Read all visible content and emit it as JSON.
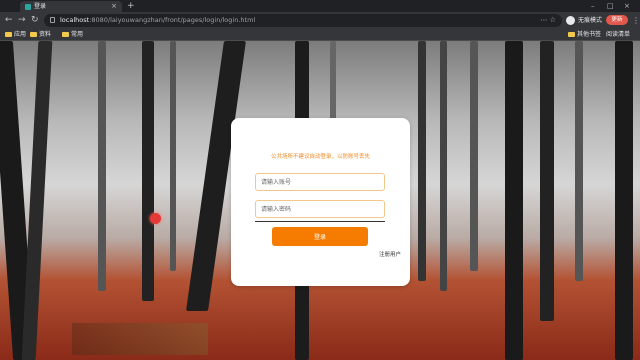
{
  "browser": {
    "tab_title": "登录",
    "tab_close": "×",
    "new_tab": "+",
    "window_controls": [
      "–",
      "□",
      "×"
    ],
    "nav": {
      "back": "←",
      "forward": "→",
      "reload": "↻"
    },
    "url_host": "localhost",
    "url_path": ":8080/laiyouwangzhan/front/pages/login/login.html",
    "omnibox_icons": "⋯ ☆",
    "profile_label": "无痕模式",
    "update_label": "更新",
    "menu": "⋮",
    "bookmarks": {
      "apps": "应用",
      "resources": "资料",
      "common": "常用",
      "other_bookmarks": "其他书签",
      "reading_list": "阅读清单"
    }
  },
  "login": {
    "notice": "公共场所不建议自动登录，以防账号丢失",
    "account_placeholder": "请输入账号",
    "password_placeholder": "请输入密码",
    "login_button": "登录",
    "register_link": "注册用户"
  },
  "colors": {
    "accent": "#f57c00",
    "notice": "#f08a24",
    "input_border": "#f0c98a"
  }
}
